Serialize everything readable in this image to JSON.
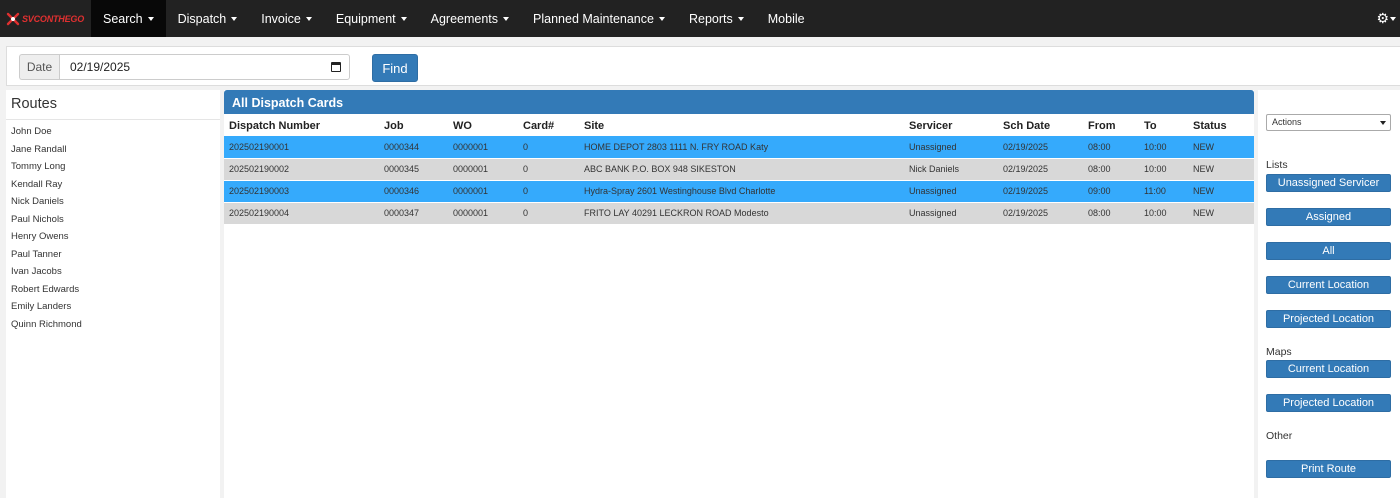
{
  "nav": {
    "brand": "SVCONTHEGO",
    "items": [
      {
        "label": "Search",
        "has_caret": true,
        "active": true
      },
      {
        "label": "Dispatch",
        "has_caret": true
      },
      {
        "label": "Invoice",
        "has_caret": true
      },
      {
        "label": "Equipment",
        "has_caret": true
      },
      {
        "label": "Agreements",
        "has_caret": true
      },
      {
        "label": "Planned Maintenance",
        "has_caret": true
      },
      {
        "label": "Reports",
        "has_caret": true
      },
      {
        "label": "Mobile",
        "has_caret": false
      }
    ],
    "settings_icon": "gear-icon"
  },
  "datebar": {
    "date_label": "Date",
    "date_value": "02/19/2025",
    "find_label": "Find"
  },
  "routes": {
    "title": "Routes",
    "items": [
      "John Doe",
      "Jane Randall",
      "Tommy Long",
      "Kendall Ray",
      "Nick Daniels",
      "Paul Nichols",
      "Henry Owens",
      "Paul Tanner",
      "Ivan Jacobs",
      "Robert Edwards",
      "Emily Landers",
      "Quinn Richmond"
    ]
  },
  "dispatch": {
    "title": "All Dispatch Cards",
    "columns": [
      "Dispatch Number",
      "Job",
      "WO",
      "Card#",
      "Site",
      "Servicer",
      "Sch Date",
      "From",
      "To",
      "Status"
    ],
    "rows": [
      {
        "dispatch_number": "202502190001",
        "job": "0000344",
        "wo": "0000001",
        "card": "0",
        "site": "HOME DEPOT 2803 1111 N. FRY ROAD Katy",
        "servicer": "Unassigned",
        "sch_date": "02/19/2025",
        "from": "08:00",
        "to": "10:00",
        "status": "NEW",
        "highlight": "blue"
      },
      {
        "dispatch_number": "202502190002",
        "job": "0000345",
        "wo": "0000001",
        "card": "0",
        "site": "ABC BANK P.O. BOX 948 SIKESTON",
        "servicer": "Nick Daniels",
        "sch_date": "02/19/2025",
        "from": "08:00",
        "to": "10:00",
        "status": "NEW",
        "highlight": "grey"
      },
      {
        "dispatch_number": "202502190003",
        "job": "0000346",
        "wo": "0000001",
        "card": "0",
        "site": "Hydra-Spray 2601 Westinghouse Blvd Charlotte",
        "servicer": "Unassigned",
        "sch_date": "02/19/2025",
        "from": "09:00",
        "to": "11:00",
        "status": "NEW",
        "highlight": "blue"
      },
      {
        "dispatch_number": "202502190004",
        "job": "0000347",
        "wo": "0000001",
        "card": "0",
        "site": "FRITO LAY 40291 LECKRON ROAD Modesto",
        "servicer": "Unassigned",
        "sch_date": "02/19/2025",
        "from": "08:00",
        "to": "10:00",
        "status": "NEW",
        "highlight": "grey"
      }
    ]
  },
  "side": {
    "actions_label": "Actions",
    "lists_label": "Lists",
    "lists_buttons": [
      "Unassigned Servicer",
      "Assigned",
      "All",
      "Current Location",
      "Projected Location"
    ],
    "maps_label": "Maps",
    "maps_buttons": [
      "Current Location",
      "Projected Location"
    ],
    "other_label": "Other",
    "other_buttons": [
      "Print Route"
    ]
  },
  "colors": {
    "navbar": "#222222",
    "primary": "#337ab7",
    "row_highlight": "#35aafc",
    "row_alt": "#d8d8d8",
    "brand_red": "#e03030"
  }
}
